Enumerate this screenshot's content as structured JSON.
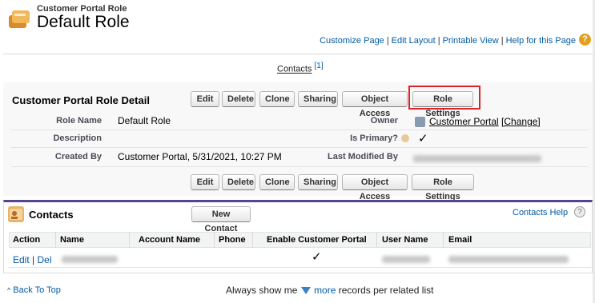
{
  "header": {
    "record_type": "Customer Portal Role",
    "title": "Default Role"
  },
  "top_links": {
    "customize": "Customize Page",
    "edit_layout": "Edit Layout",
    "printable": "Printable View",
    "help": "Help for this Page",
    "sep": "|"
  },
  "related_link": {
    "label": "Contacts",
    "count": "[1]"
  },
  "detail": {
    "title": "Customer Portal Role Detail",
    "buttons": [
      "Edit",
      "Delete",
      "Clone",
      "Sharing",
      "Object Access",
      "Role Settings"
    ],
    "fields": {
      "role_name_label": "Role Name",
      "role_name_value": "Default Role",
      "owner_label": "Owner",
      "owner_value": "Customer Portal",
      "owner_change": "[Change]",
      "description_label": "Description",
      "is_primary_label": "Is Primary?",
      "is_primary_value": "✓",
      "created_by_label": "Created By",
      "created_by_value": "Customer Portal, 5/31/2021, 10:27 PM",
      "last_modified_label": "Last Modified By"
    }
  },
  "contacts_list": {
    "title": "Contacts",
    "new_button": "New Contact",
    "help_link": "Contacts Help",
    "columns": [
      "Action",
      "Name",
      "Account Name",
      "Phone",
      "Enable Customer Portal",
      "User Name",
      "Email"
    ],
    "row": {
      "edit": "Edit",
      "sep": "|",
      "del": "Del",
      "enable_portal": "✓"
    }
  },
  "footer": {
    "back_to_top": "Back To Top",
    "always_show": "Always show me",
    "more": "more",
    "records_per": "records per related list"
  },
  "colors": {
    "link": "#015ba7",
    "highlight": "#d9262b",
    "list_accent": "#56458c"
  },
  "icons": [
    "role-icon",
    "help-icon",
    "user-icon",
    "info-icon",
    "contacts-icon",
    "question-icon",
    "triangle-down-icon"
  ]
}
